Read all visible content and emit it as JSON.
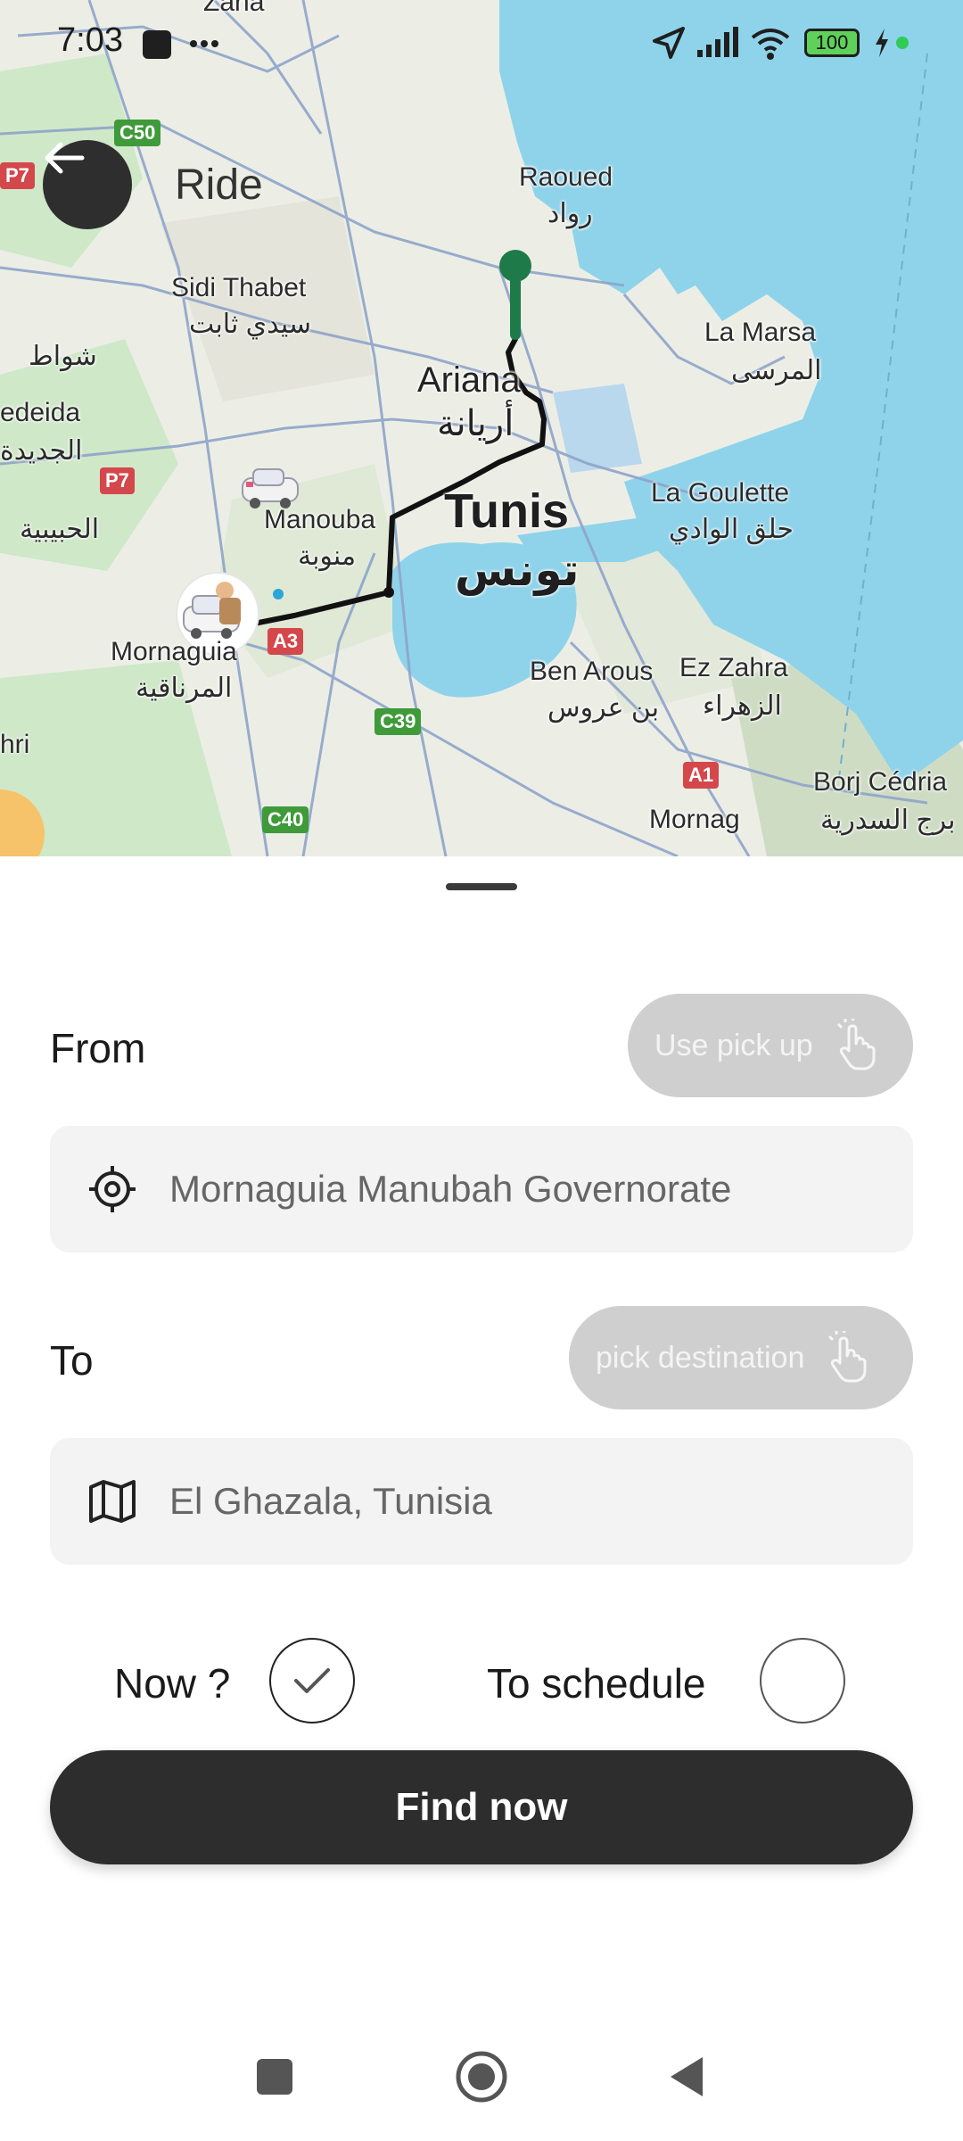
{
  "status_bar": {
    "time": "7:03",
    "battery": "100"
  },
  "header": {
    "title": "Ride"
  },
  "map": {
    "labels": {
      "raoued": "Raoued",
      "raoued_ar": "رواد",
      "la_marsa": "La Marsa",
      "la_marsa_ar": "المرسى",
      "sidi_thabet": "Sidi Thabet",
      "sidi_thabet_ar": "سيدي ثابت",
      "ariana": "Ariana",
      "ariana_ar": "أريانة",
      "tunis": "Tunis",
      "tunis_ar": "تونس",
      "la_goulette": "La Goulette",
      "la_goulette_ar": "حلق الوادي",
      "manouba": "Manouba",
      "manouba_ar": "منوبة",
      "mornaguia": "Mornaguia",
      "mornaguia_ar": "المرناقية",
      "ben_arous": "Ben Arous",
      "ben_arous_ar": "بن عروس",
      "ez_zahra": "Ez Zahra",
      "ez_zahra_ar": "الزهراء",
      "borj_cedria": "Borj Cédria",
      "borj_cedria_ar": "برج السدرية",
      "mornag": "Mornag",
      "jedeida": "edeida",
      "jedeida_ar": "الجديدة",
      "chouat_ar": "شواط",
      "hbibia_ar": "الحبيبية",
      "zana": "Zana",
      "hri": "hri"
    },
    "road_badges": {
      "c50": "C50",
      "p7_top": "P7",
      "p7_mid": "P7",
      "a3": "A3",
      "c39": "C39",
      "c40": "C40",
      "a1": "A1"
    }
  },
  "form": {
    "from_label": "From",
    "use_pickup_label": "Use pick up",
    "from_value": "Mornaguia Manubah Governorate",
    "to_label": "To",
    "pick_destination_label": "pick destination",
    "to_value": "El Ghazala, Tunisia",
    "now_label": "Now ?",
    "now_selected": true,
    "schedule_label": "To schedule",
    "schedule_selected": false,
    "find_button": "Find now"
  },
  "icons": {
    "back": "arrow-left-icon",
    "from_field": "location-target-icon",
    "to_field": "map-icon",
    "pill": "hand-pointer-icon",
    "check": "checkmark-icon"
  },
  "colors": {
    "water": "#8fd3ea",
    "dark": "#2d2d2d",
    "pill": "#cfcfcf",
    "field_bg": "#f3f3f3",
    "pin": "#1f7a4a"
  }
}
